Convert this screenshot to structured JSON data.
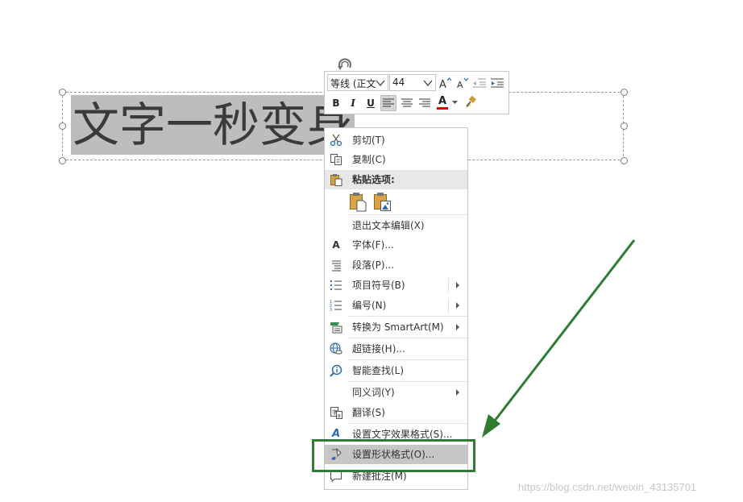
{
  "slide": {
    "text": "文字一秒变身"
  },
  "mini_toolbar": {
    "font_name": "等线 (正文",
    "font_size": "44",
    "bold": "B",
    "italic": "I",
    "underline": "U",
    "font_color_letter": "A"
  },
  "context_menu": {
    "items": [
      {
        "label": "剪切(T)",
        "icon": "scissors-icon"
      },
      {
        "label": "复制(C)",
        "icon": "copy-icon"
      },
      {
        "label": "粘贴选项:",
        "icon": "paste-icon"
      },
      {
        "label": "退出文本编辑(X)"
      },
      {
        "label": "字体(F)...",
        "icon": "font-icon",
        "icon_text": "A"
      },
      {
        "label": "段落(P)...",
        "icon": "paragraph-icon"
      },
      {
        "label": "项目符号(B)",
        "icon": "bullets-icon"
      },
      {
        "label": "编号(N)",
        "icon": "numbering-icon"
      },
      {
        "label": "转换为 SmartArt(M)",
        "icon": "smartart-icon"
      },
      {
        "label": "超链接(H)...",
        "icon": "hyperlink-icon"
      },
      {
        "label": "智能查找(L)",
        "icon": "smart-lookup-icon"
      },
      {
        "label": "同义词(Y)"
      },
      {
        "label": "翻译(S)",
        "icon": "translate-icon"
      },
      {
        "label": "设置文字效果格式(S)...",
        "icon": "text-effects-icon",
        "icon_text": "A"
      },
      {
        "label": "设置形状格式(O)...",
        "icon": "format-shape-icon"
      },
      {
        "label": "新建批注(M)",
        "icon": "new-comment-icon"
      }
    ],
    "paste_options": [
      "keep-source-formatting-icon",
      "picture-paste-icon"
    ]
  },
  "annotation": {
    "color": "#2e7d32"
  },
  "watermark": "https://blog.csdn.net/weixin_43135701"
}
